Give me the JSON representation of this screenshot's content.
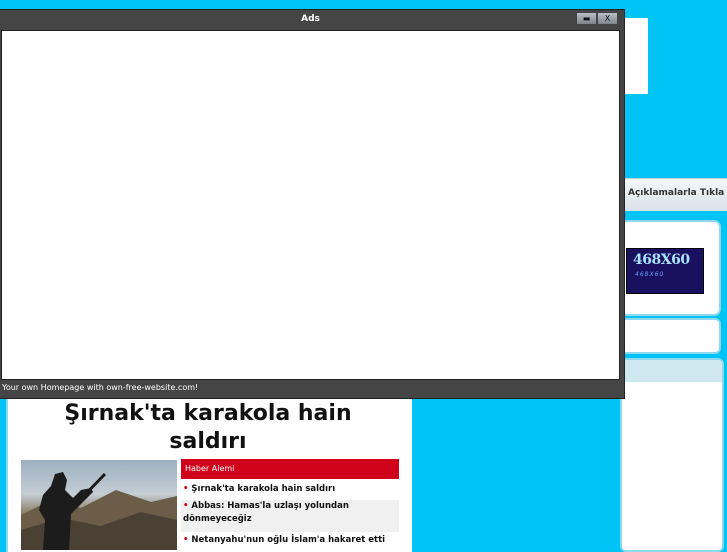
{
  "ad_window": {
    "title": "Ads",
    "minimize_icon": "▬",
    "close_label": "X",
    "footer": "Your own Homepage with own-free-website.com!"
  },
  "topbar": {
    "link_text": "Açıklamalarla Tıkla"
  },
  "banner": {
    "main": "468X60",
    "sub": "468X60"
  },
  "article": {
    "headline": "Şırnak'ta karakola hain saldırı"
  },
  "news_box": {
    "header": "Haber Alemi",
    "items": [
      {
        "bullet": "•",
        "text": "Şırnak'ta karakola hain saldırı"
      },
      {
        "bullet": "•",
        "text": "Abbas: Hamas'la uzlaşı yolundan dönmeyeceğiz"
      },
      {
        "bullet": "•",
        "text": "Netanyahu'nun oğlu İslam'a hakaret etti"
      }
    ]
  },
  "colors": {
    "page_bg": "#00c4f5",
    "news_header": "#d0021b",
    "ad_frame": "#454545"
  }
}
